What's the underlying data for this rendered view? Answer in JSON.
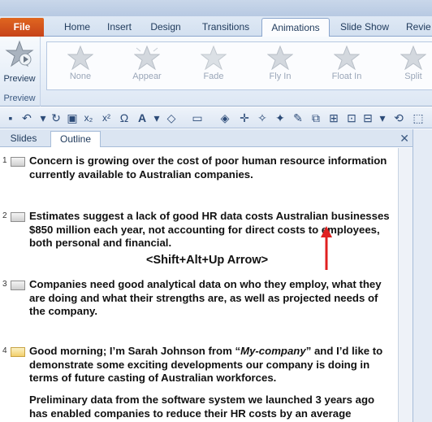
{
  "ribbon": {
    "tabs": [
      {
        "label": "File"
      },
      {
        "label": "Home"
      },
      {
        "label": "Insert"
      },
      {
        "label": "Design"
      },
      {
        "label": "Transitions"
      },
      {
        "label": "Animations"
      },
      {
        "label": "Slide Show"
      },
      {
        "label": "Revie"
      }
    ],
    "preview_button": "Preview",
    "preview_group": "Preview",
    "animations": [
      "None",
      "Appear",
      "Fade",
      "Fly In",
      "Float In",
      "Split"
    ]
  },
  "pane": {
    "tabs": [
      "Slides",
      "Outline"
    ],
    "close": "✕"
  },
  "outline": {
    "slides": [
      {
        "num": "1",
        "text": "Concern is growing over the cost of poor human resource information currently available to Australian companies."
      },
      {
        "num": "2",
        "text": "Estimates suggest a lack of good HR data costs Australian businesses $850 million each year, not accounting for direct costs to employees, both personal and financial."
      },
      {
        "num": "3",
        "text": "Companies need good analytical data on who they employ, what they are doing and what their strengths are, as well as projected needs of the company."
      },
      {
        "num": "4",
        "text_before": "Good morning; I’m Sarah Johnson from “",
        "text_em": "My-company",
        "text_after": "” and I’d like to demonstrate some exciting developments our company is doing in terms of future casting of Australian workforces.",
        "text2": "Preliminary data from the software system we launched 3 years ago has enabled companies to reduce their HR costs by an average"
      }
    ]
  },
  "annotation": {
    "shortcut": "<Shift+Alt+Up Arrow>",
    "arrow_color": "#e02020"
  },
  "colors": {
    "file_tab": "#d0521c",
    "ribbon_bg": "#dde7f4"
  }
}
